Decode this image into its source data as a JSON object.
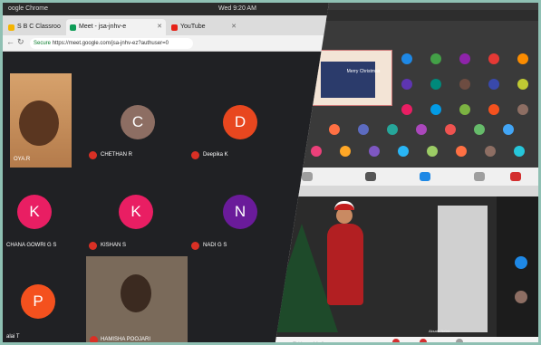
{
  "os_bar": {
    "app": "oogle Chrome",
    "clock": "Wed 9:20 AM"
  },
  "tabs": [
    {
      "label": "S B C Classroo",
      "color": "#f4b400"
    },
    {
      "label": "Meet - jsa-jnhv-e",
      "color": "#0f9d58"
    },
    {
      "label": "YouTube",
      "color": "#e62117"
    }
  ],
  "address": {
    "secure_label": "Secure",
    "url": "https://meet.google.com/jsa-jnhv-ez?authuser=0"
  },
  "participants": [
    {
      "name": "OYA.R",
      "photo": true
    },
    {
      "name": "CHETHAN R",
      "initial": "C",
      "color": "#8d6e63"
    },
    {
      "name": "Deepika K",
      "initial": "D",
      "color": "#e8471f"
    },
    {
      "name": "CHANA GOWRI G S",
      "initial": "K",
      "color": "#e91e63"
    },
    {
      "name": "KISHAN S",
      "initial": "K",
      "color": "#e91e63"
    },
    {
      "name": "NADI G S",
      "initial": "N",
      "color": "#6a1b9a"
    },
    {
      "name": "alai T",
      "initial": "P",
      "color": "#f4511e"
    },
    {
      "name": "HAMISHA POOJARI",
      "photo": true
    }
  ],
  "slide": {
    "text": "Merry Christmas"
  },
  "right_bottom": {
    "presenting": "Christmas celebration",
    "name": "Aksath Nelak"
  },
  "colors": {
    "mic_off": "#d93025",
    "meet_bg": "#202124",
    "frame": "#8fc0b3"
  }
}
